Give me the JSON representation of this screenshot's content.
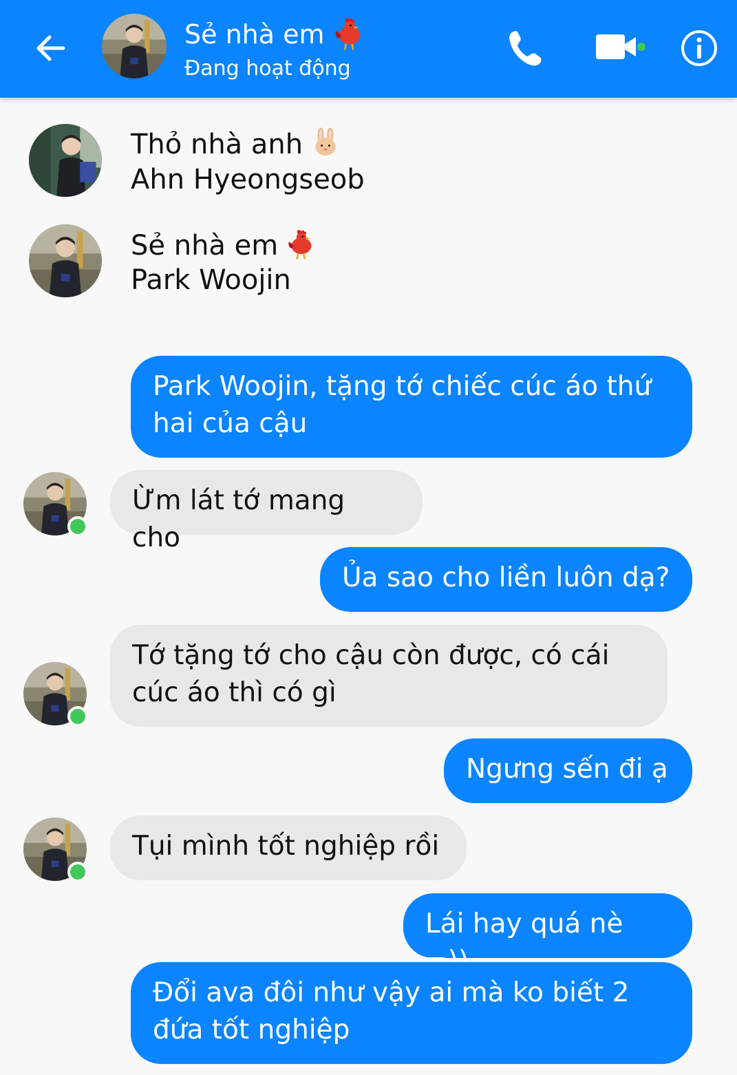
{
  "header": {
    "contact_name": "Sẻ nhà em",
    "contact_emoji": "rooster-icon",
    "status": "Đang hoạt động"
  },
  "nicknames": [
    {
      "title": "Thỏ nhà anh",
      "emoji": "rabbit-icon",
      "name": "Ahn Hyeongseob"
    },
    {
      "title": "Sẻ nhà em",
      "emoji": "rooster-icon",
      "name": "Park Woojin"
    }
  ],
  "messages": [
    {
      "direction": "outgoing",
      "text": "Park Woojin, tặng tớ chiếc cúc áo thứ hai của cậu"
    },
    {
      "direction": "incoming",
      "text": "Ừm lát tớ mang cho"
    },
    {
      "direction": "outgoing",
      "text": "Ủa sao cho liền luôn dạ?"
    },
    {
      "direction": "incoming",
      "text": "Tớ tặng tớ cho cậu còn được, có cái cúc áo thì có gì"
    },
    {
      "direction": "outgoing",
      "text": "Ngưng sến đi ạ"
    },
    {
      "direction": "incoming",
      "text": "Tụi mình tốt nghiệp rồi"
    },
    {
      "direction": "outgoing",
      "text": "Lái hay quá nè =))"
    },
    {
      "direction": "outgoing",
      "text": "Đổi ava đôi như vậy ai mà ko biết 2 đứa tốt nghiệp"
    }
  ],
  "colors": {
    "accent": "#0a84ff",
    "incoming_bubble": "#e8e8e8",
    "online": "#44c75a",
    "background": "#f8f8f8"
  }
}
